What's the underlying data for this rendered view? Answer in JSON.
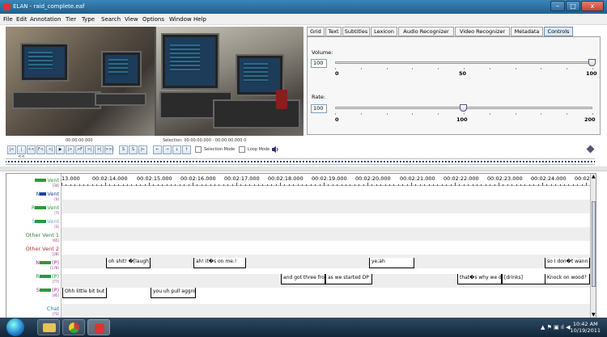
{
  "window": {
    "title": "ELAN - raid_complete.eaf",
    "min": "–",
    "max": "□",
    "close": "x"
  },
  "menu": [
    "File",
    "Edit",
    "Annotation",
    "Tier",
    "Type",
    "Search",
    "View",
    "Options",
    "Window",
    "Help"
  ],
  "media": {
    "time": "00:00:00.000",
    "selection": "Selection: 00:00:00.000 - 00:00:00.000  0"
  },
  "toolbar": {
    "buttons": [
      "|<",
      "|<<",
      "<<",
      "F<",
      "<|",
      "▶",
      "|>",
      ">F",
      ">|",
      ">|",
      ">>|"
    ],
    "sel_buttons": [
      "S",
      "S",
      "|←"
    ],
    "arrows": [
      "←",
      "→",
      "↓",
      "↑"
    ],
    "selection_mode": "Selection Mode",
    "loop_mode": "Loop Mode"
  },
  "tabs": [
    "Grid",
    "Text",
    "Subtitles",
    "Lexicon",
    "Audio Recognizer",
    "Video Recognizer",
    "Metadata",
    "Controls"
  ],
  "active_tab": "Controls",
  "controls": {
    "volume": {
      "label": "Volume:",
      "value": "100",
      "ticks": [
        "0",
        "50",
        "100"
      ],
      "level": 100
    },
    "rate": {
      "label": "Rate:",
      "value": "100",
      "ticks": [
        "0",
        "100",
        "200"
      ],
      "level": 100
    }
  },
  "ruler": [
    "13.000",
    "00:02:14.000",
    "00:02:15.000",
    "00:02:16.000",
    "00:02:17.000",
    "00:02:18.000",
    "00:02:19.000",
    "00:02:20.000",
    "00:02:21.000",
    "00:02:22.000",
    "00:02:23.000",
    "00:02:24.000",
    "00:02:"
  ],
  "tiers": [
    {
      "name": "Vent",
      "count": "[34]",
      "color": "#2a9a3a",
      "blot": true
    },
    {
      "name": "Vent",
      "count": "[0]",
      "color": "#1a3fa8",
      "prefix": "N"
    },
    {
      "name": "Vent",
      "count": "[7]",
      "color": "#2a9a3a",
      "prefix": "R",
      "blot": true
    },
    {
      "name": "Vent",
      "count": "[3]",
      "color": "#7aa3c8",
      "prefix": "S",
      "blot": true
    },
    {
      "name": "Other Vent 1",
      "count": "[65]",
      "color": "#3a7a3a"
    },
    {
      "name": "Other Vent 2",
      "count": "[28]",
      "color": "#b03030"
    },
    {
      "name": "(P)",
      "count": "[178]",
      "color": "#a12a9a",
      "prefix": "N",
      "blot": true
    },
    {
      "name": "(P)",
      "count": "[77]",
      "color": "#2a9a3a",
      "prefix": "R",
      "blot": true
    },
    {
      "name": "(P)",
      "count": "[85]",
      "color": "#a12a9a",
      "prefix": "S",
      "blot": true
    },
    {
      "name": "Chat",
      "count": "[73]",
      "color": "#2a7a9a"
    }
  ],
  "annotations": {
    "n_p": [
      "oh shit! �[laugh]",
      "ah! it�s on me.!",
      "ye;ah",
      "so I don�t wann"
    ],
    "r_p": [
      "and got three fro",
      "as we started DP",
      "that�s why we d",
      "[drinks]",
      "Knock on wood?"
    ],
    "s_p": [
      "Ohh little bit but u",
      "you uh pull aggro"
    ]
  },
  "clock": {
    "time": "10:42 AM",
    "date": "10/19/2011"
  },
  "colors": {
    "titlebar": "#2a6fa0",
    "accent": "#1f5f8d",
    "close": "#c9443a"
  }
}
